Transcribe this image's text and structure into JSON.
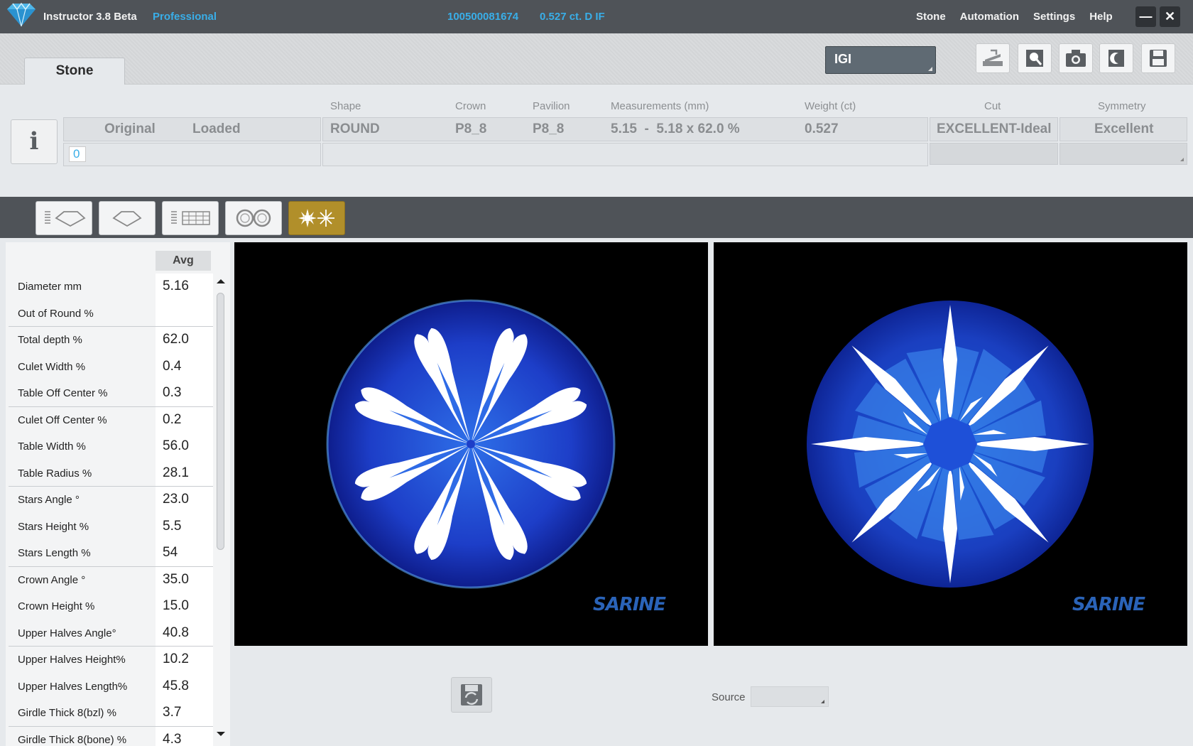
{
  "app": {
    "title": "Instructor 3.8 Beta",
    "edition": "Professional",
    "stone_id": "100500081674",
    "stone_summary": "0.527 ct.  D  IF",
    "menu": [
      "Stone",
      "Automation",
      "Settings",
      "Help"
    ]
  },
  "tabs": {
    "stone": "Stone"
  },
  "lab_select": {
    "value": "IGI"
  },
  "toolbar_icons": [
    "import-icon",
    "zoom-inspect-icon",
    "camera-icon",
    "report-icon",
    "save-icon"
  ],
  "summary": {
    "headers": {
      "shape": "Shape",
      "crown": "Crown",
      "pavilion": "Pavilion",
      "measurements": "Measurements (mm)",
      "weight": "Weight (ct)",
      "cut": "Cut",
      "symmetry": "Symmetry"
    },
    "original_label": "Original",
    "loaded_label": "Loaded",
    "counter": "0",
    "shape": "ROUND",
    "crown": "P8_8",
    "pavilion": "P8_8",
    "measurements": "5.15  -  5.18 x 62.0 %",
    "weight": "0.527",
    "cut": "EXCELLENT-Ideal",
    "symmetry": "Excellent"
  },
  "view_buttons": [
    "side-profile-list-view",
    "profile-view",
    "list-table-view",
    "double-ring-view",
    "hearts-arrows-view"
  ],
  "params": {
    "avg_header": "Avg",
    "rows": [
      {
        "label": "Diameter mm",
        "value": "5.16"
      },
      {
        "label": "Out of Round %",
        "value": ""
      },
      {
        "label": "Total depth %",
        "value": "62.0"
      },
      {
        "label": "Culet Width %",
        "value": "0.4"
      },
      {
        "label": "Table Off Center %",
        "value": "0.3"
      },
      {
        "label": "Culet Off Center %",
        "value": "0.2"
      },
      {
        "label": "Table Width %",
        "value": "56.0"
      },
      {
        "label": "Table Radius %",
        "value": "28.1"
      },
      {
        "label": "Stars Angle °",
        "value": "23.0"
      },
      {
        "label": "Stars Height %",
        "value": "5.5"
      },
      {
        "label": "Stars Length %",
        "value": "54"
      },
      {
        "label": "Crown Angle °",
        "value": "35.0"
      },
      {
        "label": "Crown Height %",
        "value": "15.0"
      },
      {
        "label": "Upper Halves Angle°",
        "value": "40.8"
      },
      {
        "label": "Upper Halves Height%",
        "value": "10.2"
      },
      {
        "label": "Upper Halves Length%",
        "value": "45.8"
      },
      {
        "label": "Girdle Thick 8(bzl) %",
        "value": "3.7"
      },
      {
        "label": "Girdle Thick 8(bone) %",
        "value": "4.3"
      }
    ]
  },
  "images": {
    "watermark": "SARINE"
  },
  "bottom": {
    "source_label": "Source",
    "source_value": ""
  },
  "colors": {
    "accent_blue": "#39aee8",
    "titlebar": "#4f5358",
    "active_view": "#b18f2a",
    "diamond_blue": "#1f3fc4"
  }
}
